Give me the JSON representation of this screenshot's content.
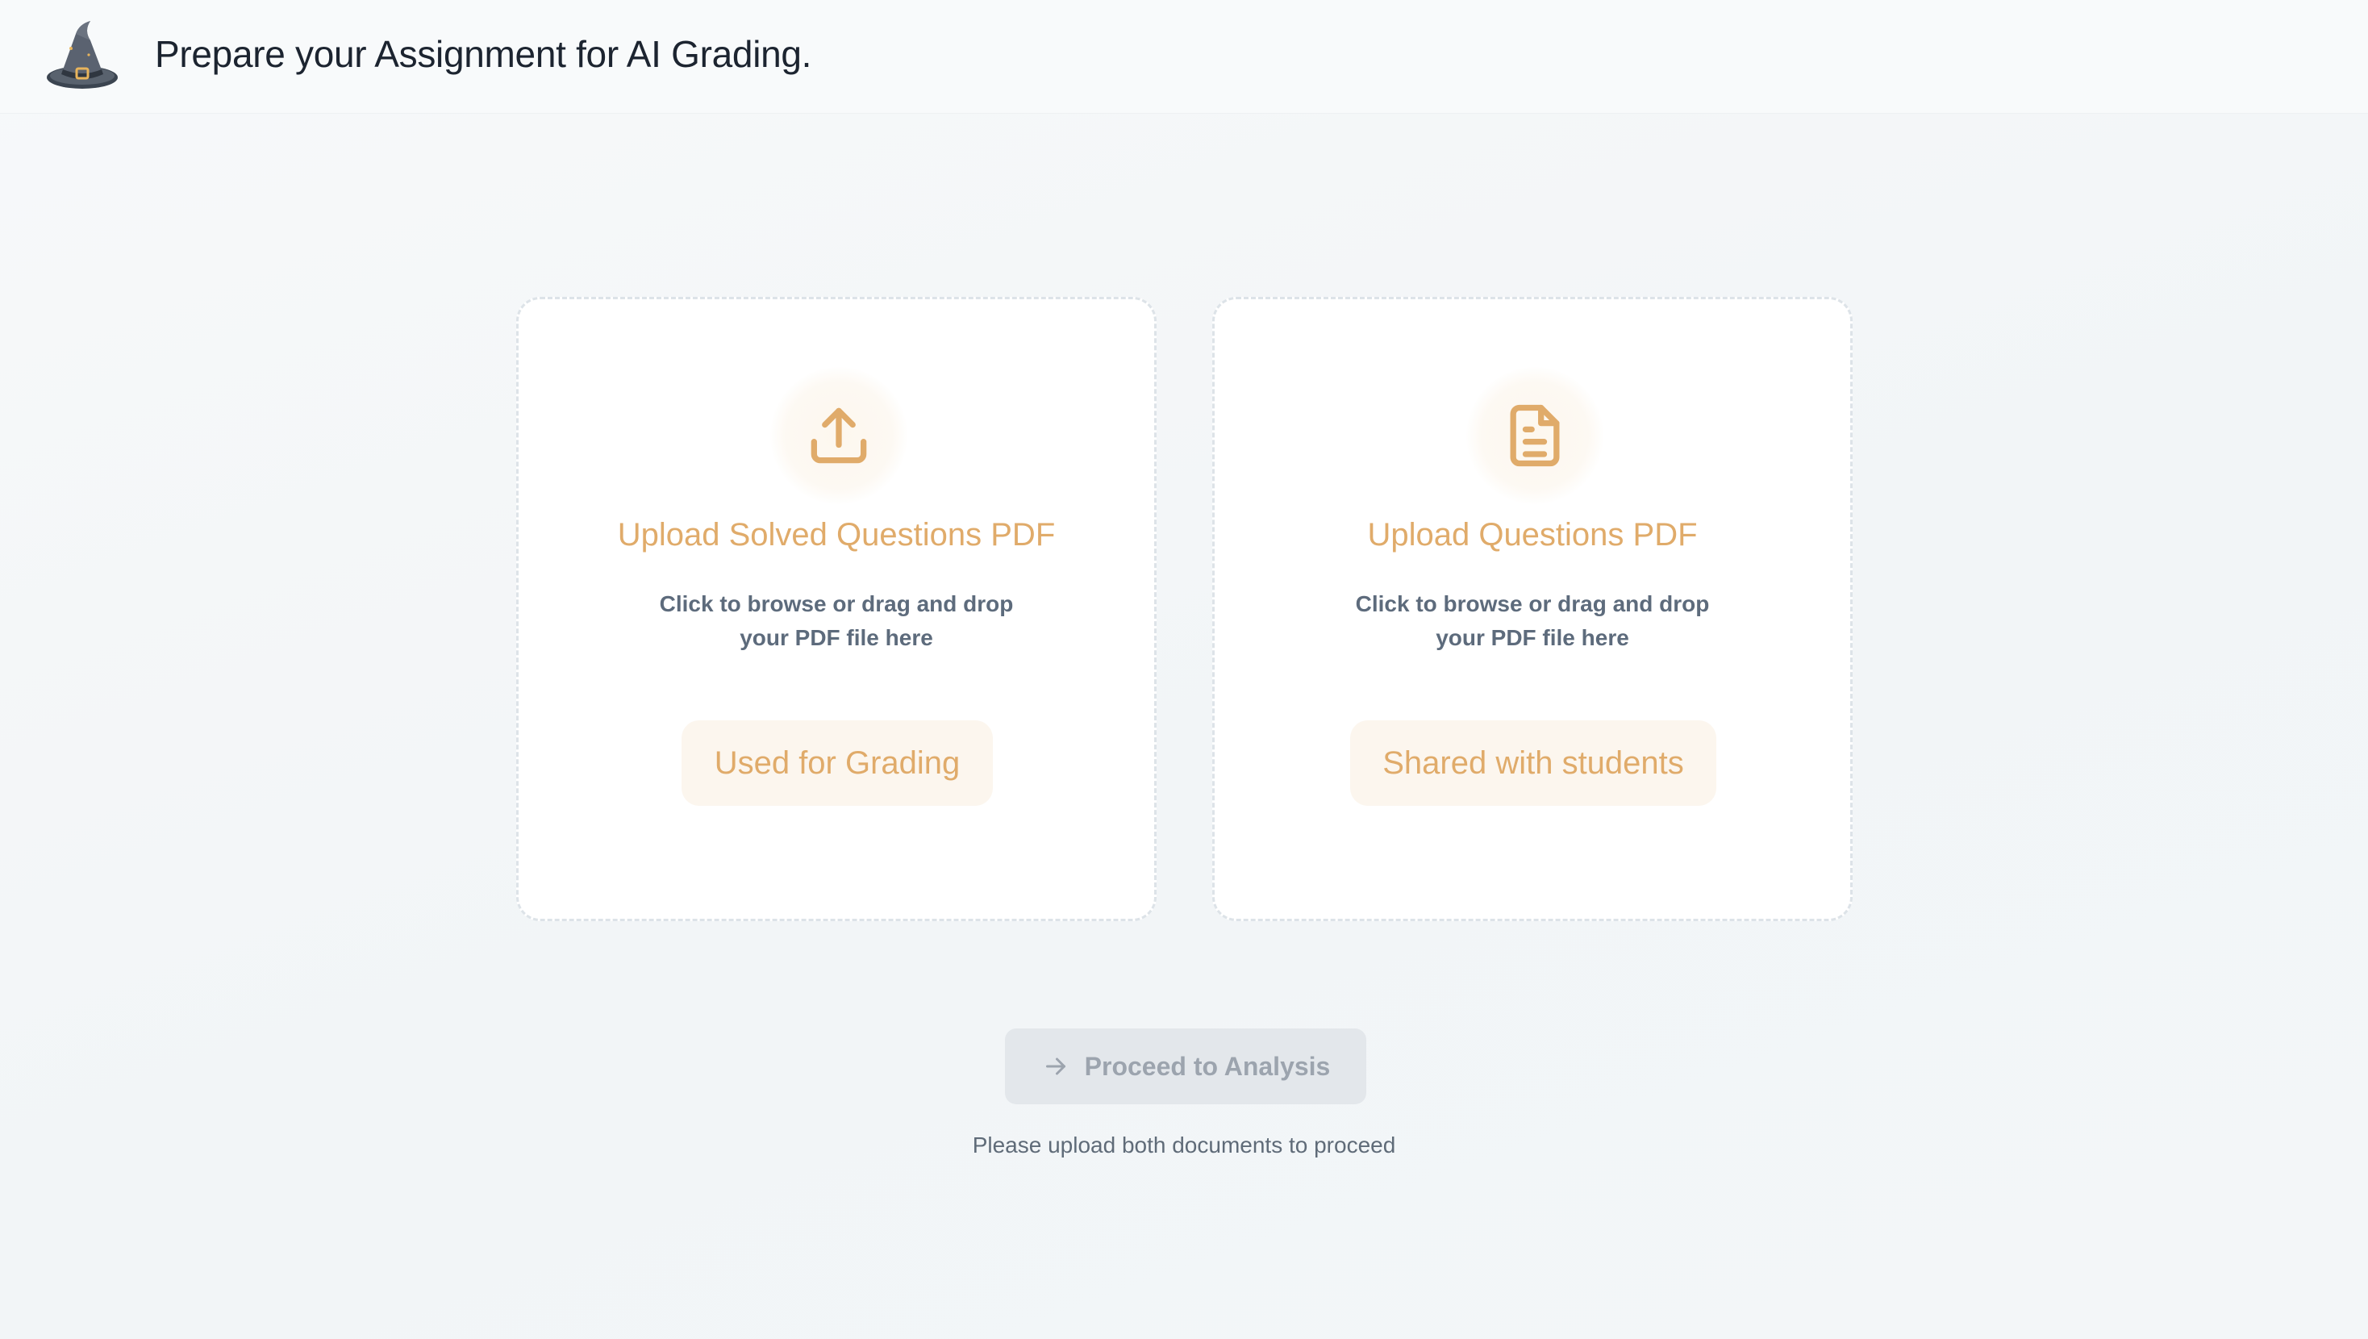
{
  "header": {
    "title": "Prepare your Assignment for AI Grading.",
    "logo_icon": "wizard-hat-icon"
  },
  "cards": [
    {
      "icon": "upload-icon",
      "title": "Upload Solved Questions PDF",
      "description": "Click to browse or drag and drop your PDF file here",
      "badge": "Used for Grading"
    },
    {
      "icon": "document-icon",
      "title": "Upload Questions PDF",
      "description": "Click to browse or drag and drop your PDF file here",
      "badge": "Shared with students"
    }
  ],
  "actions": {
    "proceed_label": "Proceed to Analysis",
    "proceed_icon": "arrow-right-icon",
    "hint": "Please upload both documents to proceed"
  },
  "colors": {
    "accent": "#e0ab6a",
    "accent_bg": "#fcf6ee",
    "disabled_bg": "#e3e7eb",
    "disabled_text": "#9ca4ae",
    "text_dark": "#1c2430",
    "text_muted": "#5d6b7c"
  }
}
